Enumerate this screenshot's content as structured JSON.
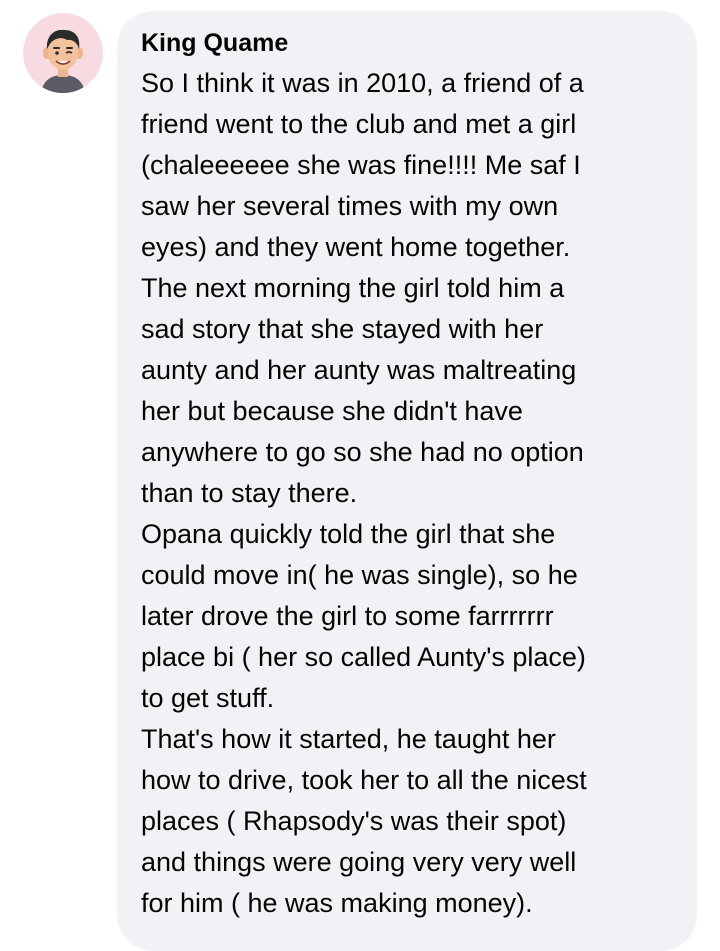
{
  "comment": {
    "author": "King Quame",
    "lines": [
      "So I think it was in 2010, a friend of a",
      "friend went to the club and met a girl",
      "(chaleeeeee she was fine!!!! Me saf I",
      "saw her several times with my own",
      "eyes) and they went home together.",
      "The next morning the girl told him a",
      "sad story that she stayed with her",
      "aunty and her aunty was maltreating",
      "her but because she didn't have",
      "anywhere to go so she had no option",
      "than to stay there.",
      "Opana quickly told the girl that she",
      "could move in( he was single), so he",
      "later drove the girl to some farrrrrrr",
      "place bi ( her so called Aunty's place)",
      "to get stuff.",
      "That's how it started, he taught her",
      "how to drive, took her to all the nicest",
      "places ( Rhapsody's was their spot)",
      "and things were going very very well",
      "for him ( he was making money)."
    ]
  },
  "avatar": {
    "icon": "avatar-icon",
    "background": "#f7dbe0"
  },
  "colors": {
    "bubble": "#f0f2f5",
    "text": "#050505"
  }
}
